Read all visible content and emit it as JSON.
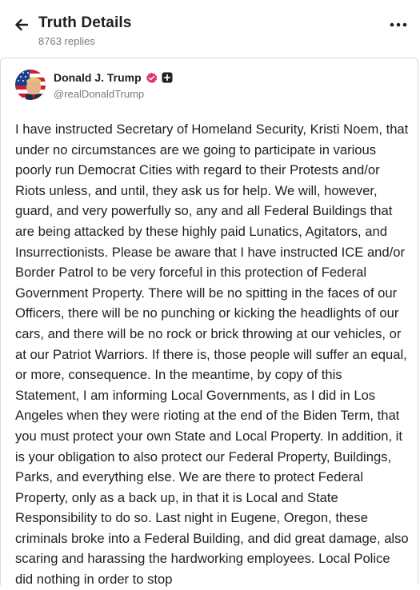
{
  "header": {
    "title": "Truth Details",
    "reply_count": "8763 replies"
  },
  "post": {
    "author": {
      "display_name": "Donald J. Trump",
      "handle": "@realDonaldTrump"
    },
    "body": "I have instructed Secretary of Homeland Security, Kristi Noem, that under no circumstances are we going to participate in various poorly run Democrat Cities with regard to their Protests and/or Riots unless, and until, they ask us for help. We will, however, guard, and very powerfully so, any and all Federal Buildings that are being attacked by these highly paid Lunatics, Agitators, and Insurrectionists. Please be aware that I have instructed ICE and/or Border Patrol to be very forceful in this protection of Federal Government Property. There will be no spitting in the faces of our Officers, there will be no punching or kicking the headlights of our cars, and there will be no rock or brick throwing at our vehicles, or at our Patriot Warriors. If there is, those people will suffer an equal, or more, consequence. In the meantime, by copy of this Statement, I am informing Local Governments, as I did in Los Angeles when they were rioting at the end of the Biden Term, that you must protect your own State and Local Property. In addition, it is your obligation to also protect our Federal Property, Buildings, Parks, and everything else. We are there to protect Federal Property, only as a back up, in that it is Local and State Responsibility to do so. Last night in Eugene, Oregon, these criminals broke into a Federal Building, and did great damage, also scaring and harassing the hardworking employees. Local Police did nothing in order to stop"
  },
  "icons": {
    "back": "arrow-left-icon",
    "more": "more-horizontal-icon",
    "verified": "verified-badge-icon",
    "plus": "plus-badge-icon"
  },
  "colors": {
    "verified": "#e0336f",
    "text": "#1f1f1f",
    "muted": "#7a7a7a"
  }
}
